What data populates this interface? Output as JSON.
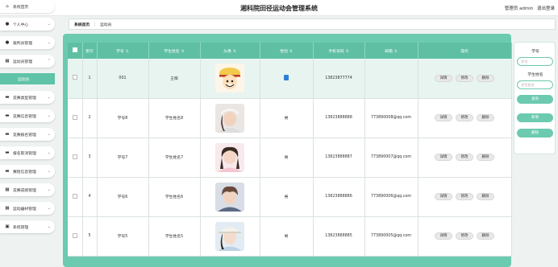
{
  "header": {
    "title": "湘科院田径运动会管理系统",
    "user_label": "管理员 admin",
    "logout": "退出登录"
  },
  "sidebar": {
    "items": [
      {
        "label": "系统首页",
        "icon": "home-icon"
      },
      {
        "label": "个人中心",
        "icon": "user-icon"
      },
      {
        "label": "裁判员管理",
        "icon": "user-icon"
      },
      {
        "label": "运动员管理",
        "icon": "grid-icon",
        "sub": "运动员"
      },
      {
        "label": "竞赛类型管理",
        "icon": "trophy-icon"
      },
      {
        "label": "竞赛信息管理",
        "icon": "trophy-icon"
      },
      {
        "label": "竞赛报名管理",
        "icon": "trophy-icon"
      },
      {
        "label": "报名取消管理",
        "icon": "trophy-icon"
      },
      {
        "label": "赛程信息管理",
        "icon": "trophy-icon"
      },
      {
        "label": "竞赛成绩管理",
        "icon": "grid-icon"
      },
      {
        "label": "运动器材管理",
        "icon": "grid-icon"
      },
      {
        "label": "系统管理",
        "icon": "box-icon"
      }
    ]
  },
  "breadcrumb": {
    "home": "系统首页",
    "sep": "⋮",
    "current": "运动员"
  },
  "table": {
    "headers": [
      "索引",
      "学号",
      "学生姓名",
      "头像",
      "性别",
      "手机号码",
      "邮箱",
      "操作"
    ],
    "rows": [
      {
        "index": "1",
        "sid": "001",
        "name": "王辉",
        "gender": "",
        "phone": "13823877774",
        "email": ""
      },
      {
        "index": "2",
        "sid": "学号8",
        "name": "学生姓名8",
        "gender": "男",
        "phone": "13823888888",
        "email": "773890008@qq.com"
      },
      {
        "index": "3",
        "sid": "学号7",
        "name": "学生姓名7",
        "gender": "男",
        "phone": "13823888887",
        "email": "773890007@qq.com"
      },
      {
        "index": "4",
        "sid": "学号6",
        "name": "学生姓名6",
        "gender": "男",
        "phone": "13823888886",
        "email": "773890006@qq.com"
      },
      {
        "index": "5",
        "sid": "学号5",
        "name": "学生姓名5",
        "gender": "男",
        "phone": "13823888885",
        "email": "773890005@qq.com"
      }
    ],
    "actions": {
      "detail": "详情",
      "edit": "修改",
      "delete": "删除"
    }
  },
  "search": {
    "sid_label": "学号",
    "sid_placeholder": "学号",
    "name_label": "学生姓名",
    "name_placeholder": "学生姓名",
    "query": "查询",
    "add": "新增",
    "delete": "删除"
  },
  "colors": {
    "accent": "#6ccab0",
    "header": "#5fbfa3"
  }
}
